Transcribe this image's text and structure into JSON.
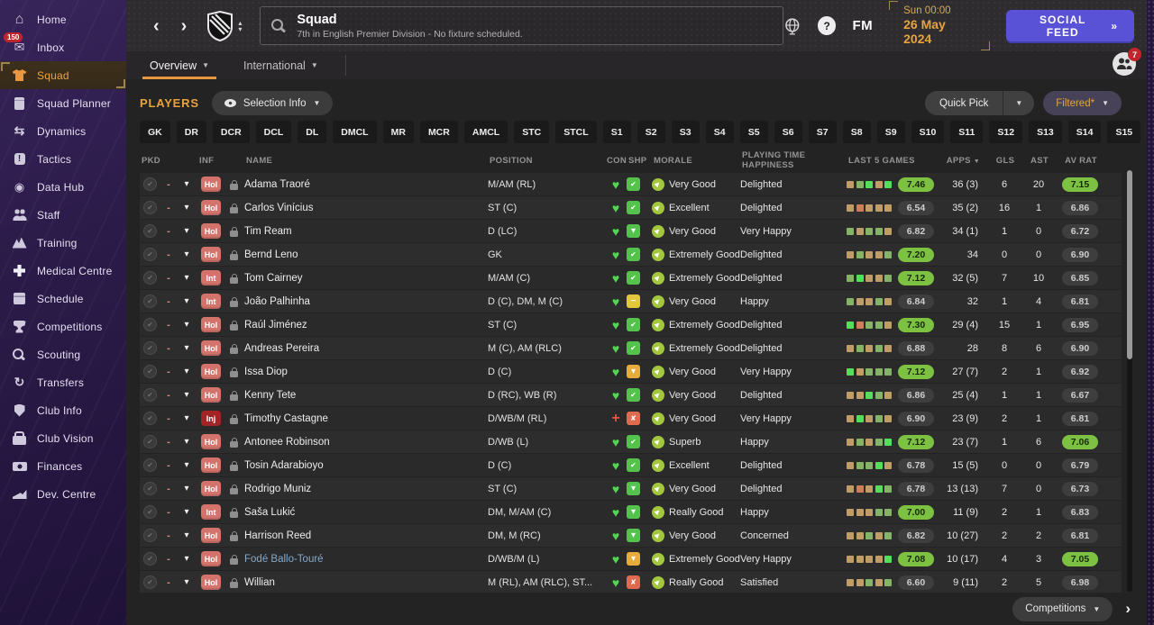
{
  "colors": {
    "accent_orange": "#E8A33D",
    "social_purple": "#5A52D6",
    "rating_green": "#7CC142",
    "inf_salmon": "#D4736B",
    "inj_red": "#A32424"
  },
  "sidebar": {
    "items": [
      {
        "label": "Home",
        "icon": "home"
      },
      {
        "label": "Inbox",
        "icon": "inbox",
        "badge": "150"
      },
      {
        "label": "Squad",
        "icon": "shirt",
        "state": "active"
      },
      {
        "label": "Squad Planner",
        "icon": "clipboard"
      },
      {
        "label": "Dynamics",
        "icon": "dynamics"
      },
      {
        "label": "Tactics",
        "icon": "tactics"
      },
      {
        "label": "Data Hub",
        "icon": "data-hub"
      },
      {
        "label": "Staff",
        "icon": "staff"
      },
      {
        "label": "Training",
        "icon": "training"
      },
      {
        "label": "Medical Centre",
        "icon": "medical"
      },
      {
        "label": "Schedule",
        "icon": "schedule"
      },
      {
        "label": "Competitions",
        "icon": "trophy"
      },
      {
        "label": "Scouting",
        "icon": "scouting",
        "sep": true
      },
      {
        "label": "Transfers",
        "icon": "transfers"
      },
      {
        "label": "Club Info",
        "icon": "club-info",
        "sep": true
      },
      {
        "label": "Club Vision",
        "icon": "club-vision"
      },
      {
        "label": "Finances",
        "icon": "finances"
      },
      {
        "label": "Dev. Centre",
        "icon": "dev-centre",
        "sep": true
      }
    ]
  },
  "header": {
    "title": "Squad",
    "subtitle": "7th in English Premier Division - No fixture scheduled.",
    "fm_logo": "FM",
    "help_label": "?",
    "time": "Sun 00:00",
    "date": "26 May 2024",
    "social_feed_label": "SOCIAL FEED",
    "social_feed_chevron": "»",
    "avatar_badge": "7"
  },
  "tabs": [
    {
      "label": "Overview"
    },
    {
      "label": "International"
    }
  ],
  "toolbar": {
    "players_label": "PLAYERS",
    "selection_info_label": "Selection Info",
    "quick_pick_label": "Quick Pick",
    "filtered_label": "Filtered*"
  },
  "filters": {
    "positions": [
      "GK",
      "DR",
      "DCR",
      "DCL",
      "DL",
      "DMCL",
      "MR",
      "MCR",
      "AMCL",
      "STC",
      "STCL",
      "S1",
      "S2",
      "S3",
      "S4",
      "S5",
      "S6",
      "S7",
      "S8",
      "S9",
      "S10",
      "S11",
      "S12",
      "S13",
      "S14",
      "S15"
    ]
  },
  "table": {
    "headers": {
      "pkd": "PKD",
      "inf": "INF",
      "name": "NAME",
      "position": "POSITION",
      "con": "CON",
      "shp": "SHP",
      "morale": "MORALE",
      "pth": "PLAYING TIME HAPPINESS",
      "last5": "LAST 5 GAMES",
      "apps": "APPS",
      "gls": "GLS",
      "ast": "AST",
      "avrat": "AV RAT"
    },
    "rows": [
      {
        "inf": "Hol",
        "inf_type": "hol",
        "name": "Adama Traoré",
        "pos": "M/AM (RL)",
        "con": "ok",
        "shp": "up",
        "morale": "Very Good",
        "pth": "Delighted",
        "l5g": [
          "t",
          "g",
          "b",
          "t",
          "b"
        ],
        "l5g_rating": "7.46",
        "l5g_style": "green",
        "apps": "36 (3)",
        "gls": "6",
        "ast": "20",
        "av_rat": "7.15",
        "av_rat_style": "green"
      },
      {
        "inf": "Hol",
        "inf_type": "hol",
        "name": "Carlos Vinícius",
        "pos": "ST (C)",
        "con": "ok",
        "shp": "up",
        "morale": "Excellent",
        "pth": "Delighted",
        "l5g": [
          "t",
          "o",
          "t",
          "t",
          "t"
        ],
        "l5g_rating": "6.54",
        "l5g_style": "gray",
        "apps": "35 (2)",
        "gls": "16",
        "ast": "1",
        "av_rat": "6.86",
        "av_rat_style": "gray"
      },
      {
        "inf": "Hol",
        "inf_type": "hol",
        "name": "Tim Ream",
        "pos": "D (LC)",
        "con": "ok",
        "shp": "downg",
        "morale": "Very Good",
        "pth": "Very Happy",
        "l5g": [
          "g",
          "t",
          "g",
          "g",
          "t"
        ],
        "l5g_rating": "6.82",
        "l5g_style": "gray",
        "apps": "34 (1)",
        "gls": "1",
        "ast": "0",
        "av_rat": "6.72",
        "av_rat_style": "gray"
      },
      {
        "inf": "Hol",
        "inf_type": "hol",
        "name": "Bernd Leno",
        "pos": "GK",
        "con": "ok",
        "shp": "up",
        "morale": "Extremely Good",
        "pth": "Delighted",
        "l5g": [
          "t",
          "g",
          "t",
          "t",
          "g"
        ],
        "l5g_rating": "7.20",
        "l5g_style": "green",
        "apps": "34",
        "gls": "0",
        "ast": "0",
        "av_rat": "6.90",
        "av_rat_style": "gray"
      },
      {
        "inf": "Int",
        "inf_type": "int",
        "name": "Tom Cairney",
        "pos": "M/AM (C)",
        "con": "ok",
        "shp": "up",
        "morale": "Extremely Good",
        "pth": "Delighted",
        "l5g": [
          "g",
          "b",
          "t",
          "t",
          "g"
        ],
        "l5g_rating": "7.12",
        "l5g_style": "green",
        "apps": "32 (5)",
        "gls": "7",
        "ast": "10",
        "av_rat": "6.85",
        "av_rat_style": "gray"
      },
      {
        "inf": "Int",
        "inf_type": "int",
        "name": "João Palhinha",
        "pos": "D (C), DM, M (C)",
        "con": "ok",
        "shp": "minus",
        "morale": "Very Good",
        "pth": "Happy",
        "l5g": [
          "g",
          "t",
          "t",
          "g",
          "t"
        ],
        "l5g_rating": "6.84",
        "l5g_style": "gray",
        "apps": "32",
        "gls": "1",
        "ast": "4",
        "av_rat": "6.81",
        "av_rat_style": "gray"
      },
      {
        "inf": "Hol",
        "inf_type": "hol",
        "name": "Raúl Jiménez",
        "pos": "ST (C)",
        "con": "ok",
        "shp": "up",
        "morale": "Extremely Good",
        "pth": "Delighted",
        "l5g": [
          "b",
          "o",
          "g",
          "g",
          "t"
        ],
        "l5g_rating": "7.30",
        "l5g_style": "green",
        "apps": "29 (4)",
        "gls": "15",
        "ast": "1",
        "av_rat": "6.95",
        "av_rat_style": "gray"
      },
      {
        "inf": "Hol",
        "inf_type": "hol",
        "name": "Andreas Pereira",
        "pos": "M (C), AM (RLC)",
        "con": "ok",
        "shp": "up",
        "morale": "Extremely Good",
        "pth": "Delighted",
        "l5g": [
          "t",
          "g",
          "t",
          "g",
          "t"
        ],
        "l5g_rating": "6.88",
        "l5g_style": "gray",
        "apps": "28",
        "gls": "8",
        "ast": "6",
        "av_rat": "6.90",
        "av_rat_style": "gray"
      },
      {
        "inf": "Hol",
        "inf_type": "hol",
        "name": "Issa Diop",
        "pos": "D (C)",
        "con": "ok",
        "shp": "downy",
        "morale": "Very Good",
        "pth": "Very Happy",
        "l5g": [
          "b",
          "t",
          "g",
          "g",
          "g"
        ],
        "l5g_rating": "7.12",
        "l5g_style": "green",
        "apps": "27 (7)",
        "gls": "2",
        "ast": "1",
        "av_rat": "6.92",
        "av_rat_style": "gray"
      },
      {
        "inf": "Hol",
        "inf_type": "hol",
        "name": "Kenny Tete",
        "pos": "D (RC), WB (R)",
        "con": "ok",
        "shp": "up",
        "morale": "Very Good",
        "pth": "Delighted",
        "l5g": [
          "t",
          "t",
          "b",
          "g",
          "t"
        ],
        "l5g_rating": "6.86",
        "l5g_style": "gray",
        "apps": "25 (4)",
        "gls": "1",
        "ast": "1",
        "av_rat": "6.67",
        "av_rat_style": "gray"
      },
      {
        "inf": "Inj",
        "inf_type": "inj",
        "name": "Timothy Castagne",
        "pos": "D/WB/M (RL)",
        "con": "inj",
        "shp": "down",
        "morale": "Very Good",
        "pth": "Very Happy",
        "l5g": [
          "t",
          "b",
          "t",
          "g",
          "t"
        ],
        "l5g_rating": "6.90",
        "l5g_style": "gray",
        "apps": "23 (9)",
        "gls": "2",
        "ast": "1",
        "av_rat": "6.81",
        "av_rat_style": "gray"
      },
      {
        "inf": "Hol",
        "inf_type": "hol",
        "name": "Antonee Robinson",
        "pos": "D/WB (L)",
        "con": "ok",
        "shp": "up",
        "morale": "Superb",
        "pth": "Happy",
        "l5g": [
          "t",
          "g",
          "t",
          "g",
          "b"
        ],
        "l5g_rating": "7.12",
        "l5g_style": "green",
        "apps": "23 (7)",
        "gls": "1",
        "ast": "6",
        "av_rat": "7.06",
        "av_rat_style": "green"
      },
      {
        "inf": "Hol",
        "inf_type": "hol",
        "name": "Tosin Adarabioyo",
        "pos": "D (C)",
        "con": "ok",
        "shp": "up",
        "morale": "Excellent",
        "pth": "Delighted",
        "l5g": [
          "t",
          "g",
          "g",
          "b",
          "t"
        ],
        "l5g_rating": "6.78",
        "l5g_style": "gray",
        "apps": "15 (5)",
        "gls": "0",
        "ast": "0",
        "av_rat": "6.79",
        "av_rat_style": "gray"
      },
      {
        "inf": "Hol",
        "inf_type": "hol",
        "name": "Rodrigo Muniz",
        "pos": "ST (C)",
        "con": "ok",
        "shp": "downg",
        "morale": "Very Good",
        "pth": "Delighted",
        "l5g": [
          "t",
          "o",
          "t",
          "b",
          "g"
        ],
        "l5g_rating": "6.78",
        "l5g_style": "gray",
        "apps": "13 (13)",
        "gls": "7",
        "ast": "0",
        "av_rat": "6.73",
        "av_rat_style": "gray"
      },
      {
        "inf": "Int",
        "inf_type": "int",
        "name": "Saša Lukić",
        "pos": "DM, M/AM (C)",
        "con": "ok",
        "shp": "downg",
        "morale": "Really Good",
        "pth": "Happy",
        "l5g": [
          "t",
          "t",
          "t",
          "g",
          "g"
        ],
        "l5g_rating": "7.00",
        "l5g_style": "green",
        "apps": "11 (9)",
        "gls": "2",
        "ast": "1",
        "av_rat": "6.83",
        "av_rat_style": "gray"
      },
      {
        "inf": "Hol",
        "inf_type": "hol",
        "name": "Harrison Reed",
        "pos": "DM, M (RC)",
        "con": "ok",
        "shp": "downg",
        "morale": "Very Good",
        "pth": "Concerned",
        "l5g": [
          "t",
          "t",
          "g",
          "t",
          "g"
        ],
        "l5g_rating": "6.82",
        "l5g_style": "gray",
        "apps": "10 (27)",
        "gls": "2",
        "ast": "2",
        "av_rat": "6.81",
        "av_rat_style": "gray"
      },
      {
        "inf": "Hol",
        "inf_type": "hol",
        "name": "Fodé Ballo-Touré",
        "name_style": "loan",
        "pos": "D/WB/M (L)",
        "con": "ok",
        "shp": "downy",
        "morale": "Extremely Good",
        "pth": "Very Happy",
        "l5g": [
          "t",
          "t",
          "t",
          "t",
          "b"
        ],
        "l5g_rating": "7.08",
        "l5g_style": "green",
        "apps": "10 (17)",
        "gls": "4",
        "ast": "3",
        "av_rat": "7.05",
        "av_rat_style": "green"
      },
      {
        "inf": "Hol",
        "inf_type": "hol",
        "name": "Willian",
        "pos": "M (RL), AM (RLC), ST...",
        "con": "ok",
        "shp": "down",
        "morale": "Really Good",
        "pth": "Satisfied",
        "l5g": [
          "t",
          "t",
          "g",
          "t",
          "g"
        ],
        "l5g_rating": "6.60",
        "l5g_style": "gray",
        "apps": "9 (11)",
        "gls": "2",
        "ast": "5",
        "av_rat": "6.98",
        "av_rat_style": "gray"
      }
    ]
  },
  "footer": {
    "competitions_label": "Competitions"
  }
}
